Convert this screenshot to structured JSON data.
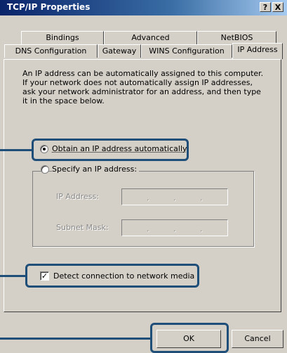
{
  "window": {
    "title": "TCP/IP Properties",
    "help_label": "?",
    "close_label": "X"
  },
  "tabs": {
    "row1": [
      "Bindings",
      "Advanced",
      "NetBIOS"
    ],
    "row2": [
      "DNS Configuration",
      "Gateway",
      "WINS Configuration",
      "IP Address"
    ],
    "active": "IP Address"
  },
  "description": "An IP address can be automatically assigned to this computer. If your network does not automatically assign IP addresses, ask your network administrator for an address, and then type it in the space below.",
  "options": {
    "obtain_label": "Obtain an IP address automatically",
    "obtain_selected": true,
    "specify_label": "Specify an IP address:",
    "specify_selected": false
  },
  "fields": {
    "ip_label": "IP Address:",
    "subnet_label": "Subnet Mask:",
    "separator": "."
  },
  "detect": {
    "label": "Detect connection to network media",
    "checked": true,
    "check_glyph": "✓"
  },
  "buttons": {
    "ok": "OK",
    "cancel": "Cancel"
  },
  "colors": {
    "callout": "#1f4e79",
    "title_bar": "#0a246a"
  }
}
